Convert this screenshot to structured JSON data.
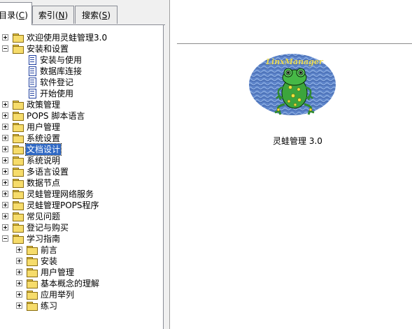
{
  "tabs": [
    {
      "prefix": "目录(",
      "key": "C",
      "suffix": ")"
    },
    {
      "prefix": "索引(",
      "key": "N",
      "suffix": ")"
    },
    {
      "prefix": "搜索(",
      "key": "S",
      "suffix": ")"
    }
  ],
  "tree": [
    {
      "label": "欢迎使用灵蛙管理3.0",
      "expand": "plus",
      "icon": "folder"
    },
    {
      "label": "安装和设置",
      "expand": "minus",
      "icon": "folder"
    },
    {
      "label": "安装与使用",
      "icon": "doc"
    },
    {
      "label": "数据库连接",
      "icon": "doc"
    },
    {
      "label": "软件登记",
      "icon": "doc"
    },
    {
      "label": "开始使用",
      "icon": "doc"
    },
    {
      "label": "政策管理",
      "expand": "plus",
      "icon": "folder"
    },
    {
      "label": "POPS 脚本语言",
      "expand": "plus",
      "icon": "folder"
    },
    {
      "label": "用户管理",
      "expand": "plus",
      "icon": "folder"
    },
    {
      "label": "系统设置",
      "expand": "plus",
      "icon": "folder"
    },
    {
      "label": "文档设计",
      "expand": "plus",
      "icon": "folder",
      "selected": true
    },
    {
      "label": "系统说明",
      "expand": "plus",
      "icon": "folder"
    },
    {
      "label": "多语言设置",
      "expand": "plus",
      "icon": "folder"
    },
    {
      "label": "数据节点",
      "expand": "plus",
      "icon": "folder"
    },
    {
      "label": "灵蛙管理网络服务",
      "expand": "plus",
      "icon": "folder"
    },
    {
      "label": "灵蛙管理POPS程序",
      "expand": "plus",
      "icon": "folder"
    },
    {
      "label": "常见问题",
      "expand": "plus",
      "icon": "folder"
    },
    {
      "label": "登记与购买",
      "expand": "plus",
      "icon": "folder"
    },
    {
      "label": "学习指南",
      "expand": "minus",
      "icon": "folder"
    },
    {
      "label": "前言",
      "expand": "plus",
      "icon": "folder"
    },
    {
      "label": "安装",
      "expand": "plus",
      "icon": "folder"
    },
    {
      "label": "用户管理",
      "expand": "plus",
      "icon": "folder"
    },
    {
      "label": "基本概念的理解",
      "expand": "plus",
      "icon": "folder"
    },
    {
      "label": "应用举列",
      "expand": "plus",
      "icon": "folder"
    },
    {
      "label": "练习",
      "expand": "plus",
      "icon": "folder"
    }
  ],
  "content": {
    "logo_text": "LinxManager",
    "caption": "灵蛙管理 3.0"
  }
}
